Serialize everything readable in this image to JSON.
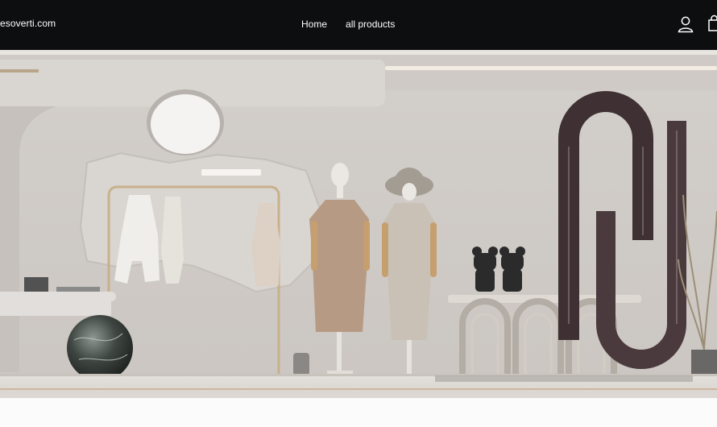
{
  "header": {
    "brand": "esoverti.com",
    "nav": [
      {
        "label": "Home"
      },
      {
        "label": "all products"
      }
    ],
    "icons": {
      "account": "user-icon",
      "cart": "shopping-bag-icon"
    }
  },
  "hero": {
    "image": "boutique-window-display"
  },
  "colors": {
    "header_bg": "#0d0e10",
    "header_text": "#ffffff",
    "page_bg": "#f8f8f8"
  }
}
